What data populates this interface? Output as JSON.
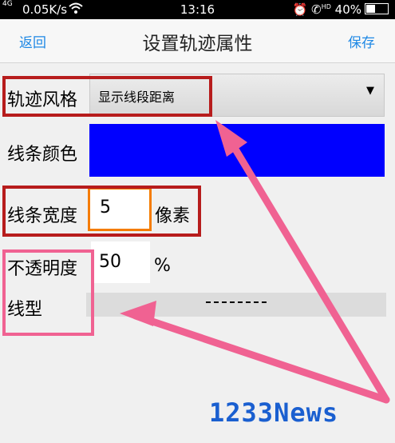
{
  "status_bar": {
    "signal": "4G",
    "network_speed": "0.05K/s",
    "time": "13:16",
    "hd": "HD",
    "battery": "40%"
  },
  "nav": {
    "back_label": "返回",
    "title": "设置轨迹属性",
    "save_label": "保存"
  },
  "form": {
    "track_style_label": "轨迹风格",
    "track_style_value": "显示线段距离",
    "line_color_label": "线条颜色",
    "line_color_value": "#0000ff",
    "line_width_label": "线条宽度",
    "line_width_value": "5",
    "line_width_unit": "像素",
    "opacity_label": "不透明度",
    "opacity_value": "50",
    "opacity_unit": "%",
    "line_type_label": "线型"
  },
  "watermark": "1233News",
  "colors": {
    "accent": "#1e88e5",
    "highlight_red": "#b71c1c",
    "highlight_orange": "#f57c00",
    "highlight_pink": "#f06292"
  }
}
